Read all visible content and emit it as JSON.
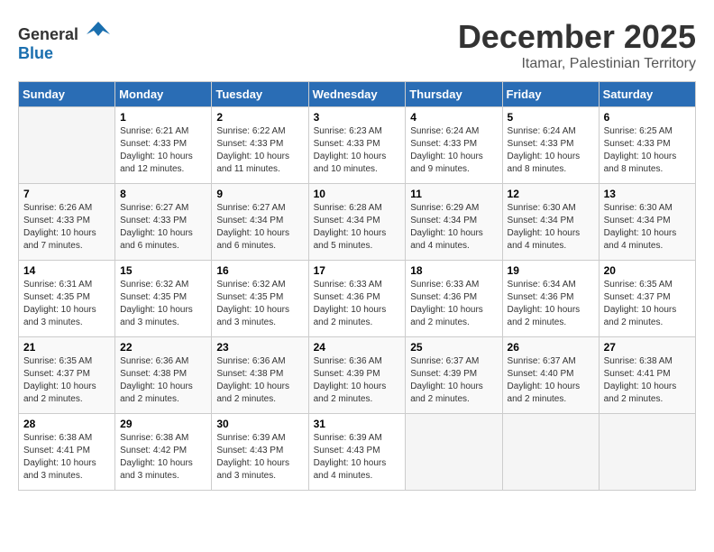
{
  "header": {
    "logo_general": "General",
    "logo_blue": "Blue",
    "month_year": "December 2025",
    "location": "Itamar, Palestinian Territory"
  },
  "days_of_week": [
    "Sunday",
    "Monday",
    "Tuesday",
    "Wednesday",
    "Thursday",
    "Friday",
    "Saturday"
  ],
  "weeks": [
    [
      {
        "day": "",
        "info": ""
      },
      {
        "day": "1",
        "info": "Sunrise: 6:21 AM\nSunset: 4:33 PM\nDaylight: 10 hours\nand 12 minutes."
      },
      {
        "day": "2",
        "info": "Sunrise: 6:22 AM\nSunset: 4:33 PM\nDaylight: 10 hours\nand 11 minutes."
      },
      {
        "day": "3",
        "info": "Sunrise: 6:23 AM\nSunset: 4:33 PM\nDaylight: 10 hours\nand 10 minutes."
      },
      {
        "day": "4",
        "info": "Sunrise: 6:24 AM\nSunset: 4:33 PM\nDaylight: 10 hours\nand 9 minutes."
      },
      {
        "day": "5",
        "info": "Sunrise: 6:24 AM\nSunset: 4:33 PM\nDaylight: 10 hours\nand 8 minutes."
      },
      {
        "day": "6",
        "info": "Sunrise: 6:25 AM\nSunset: 4:33 PM\nDaylight: 10 hours\nand 8 minutes."
      }
    ],
    [
      {
        "day": "7",
        "info": "Sunrise: 6:26 AM\nSunset: 4:33 PM\nDaylight: 10 hours\nand 7 minutes."
      },
      {
        "day": "8",
        "info": "Sunrise: 6:27 AM\nSunset: 4:33 PM\nDaylight: 10 hours\nand 6 minutes."
      },
      {
        "day": "9",
        "info": "Sunrise: 6:27 AM\nSunset: 4:34 PM\nDaylight: 10 hours\nand 6 minutes."
      },
      {
        "day": "10",
        "info": "Sunrise: 6:28 AM\nSunset: 4:34 PM\nDaylight: 10 hours\nand 5 minutes."
      },
      {
        "day": "11",
        "info": "Sunrise: 6:29 AM\nSunset: 4:34 PM\nDaylight: 10 hours\nand 4 minutes."
      },
      {
        "day": "12",
        "info": "Sunrise: 6:30 AM\nSunset: 4:34 PM\nDaylight: 10 hours\nand 4 minutes."
      },
      {
        "day": "13",
        "info": "Sunrise: 6:30 AM\nSunset: 4:34 PM\nDaylight: 10 hours\nand 4 minutes."
      }
    ],
    [
      {
        "day": "14",
        "info": "Sunrise: 6:31 AM\nSunset: 4:35 PM\nDaylight: 10 hours\nand 3 minutes."
      },
      {
        "day": "15",
        "info": "Sunrise: 6:32 AM\nSunset: 4:35 PM\nDaylight: 10 hours\nand 3 minutes."
      },
      {
        "day": "16",
        "info": "Sunrise: 6:32 AM\nSunset: 4:35 PM\nDaylight: 10 hours\nand 3 minutes."
      },
      {
        "day": "17",
        "info": "Sunrise: 6:33 AM\nSunset: 4:36 PM\nDaylight: 10 hours\nand 2 minutes."
      },
      {
        "day": "18",
        "info": "Sunrise: 6:33 AM\nSunset: 4:36 PM\nDaylight: 10 hours\nand 2 minutes."
      },
      {
        "day": "19",
        "info": "Sunrise: 6:34 AM\nSunset: 4:36 PM\nDaylight: 10 hours\nand 2 minutes."
      },
      {
        "day": "20",
        "info": "Sunrise: 6:35 AM\nSunset: 4:37 PM\nDaylight: 10 hours\nand 2 minutes."
      }
    ],
    [
      {
        "day": "21",
        "info": "Sunrise: 6:35 AM\nSunset: 4:37 PM\nDaylight: 10 hours\nand 2 minutes."
      },
      {
        "day": "22",
        "info": "Sunrise: 6:36 AM\nSunset: 4:38 PM\nDaylight: 10 hours\nand 2 minutes."
      },
      {
        "day": "23",
        "info": "Sunrise: 6:36 AM\nSunset: 4:38 PM\nDaylight: 10 hours\nand 2 minutes."
      },
      {
        "day": "24",
        "info": "Sunrise: 6:36 AM\nSunset: 4:39 PM\nDaylight: 10 hours\nand 2 minutes."
      },
      {
        "day": "25",
        "info": "Sunrise: 6:37 AM\nSunset: 4:39 PM\nDaylight: 10 hours\nand 2 minutes."
      },
      {
        "day": "26",
        "info": "Sunrise: 6:37 AM\nSunset: 4:40 PM\nDaylight: 10 hours\nand 2 minutes."
      },
      {
        "day": "27",
        "info": "Sunrise: 6:38 AM\nSunset: 4:41 PM\nDaylight: 10 hours\nand 2 minutes."
      }
    ],
    [
      {
        "day": "28",
        "info": "Sunrise: 6:38 AM\nSunset: 4:41 PM\nDaylight: 10 hours\nand 3 minutes."
      },
      {
        "day": "29",
        "info": "Sunrise: 6:38 AM\nSunset: 4:42 PM\nDaylight: 10 hours\nand 3 minutes."
      },
      {
        "day": "30",
        "info": "Sunrise: 6:39 AM\nSunset: 4:43 PM\nDaylight: 10 hours\nand 3 minutes."
      },
      {
        "day": "31",
        "info": "Sunrise: 6:39 AM\nSunset: 4:43 PM\nDaylight: 10 hours\nand 4 minutes."
      },
      {
        "day": "",
        "info": ""
      },
      {
        "day": "",
        "info": ""
      },
      {
        "day": "",
        "info": ""
      }
    ]
  ]
}
